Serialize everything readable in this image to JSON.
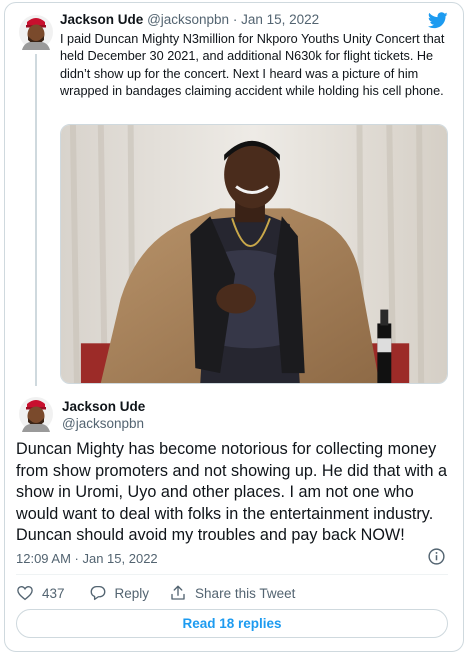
{
  "parent_tweet": {
    "author_name": "Jackson Ude",
    "author_handle": "@jacksonpbn",
    "separator": "·",
    "date": "Jan 15, 2022",
    "text": "I paid Duncan Mighty N3million for Nkporo Youths Unity Concert that held December 30 2021, and additional N630k for flight tickets. He didn’t  show up for the concert. Next I heard was a picture of him wrapped in bandages claiming accident while holding his cell phone.",
    "media": "photo of a man in a tan blazer seated in front of white curtains"
  },
  "main_tweet": {
    "author_name": "Jackson Ude",
    "author_handle": "@jacksonpbn",
    "text": "Duncan Mighty has become notorious for collecting money from show promoters and not showing up. He did that with a show in Uromi, Uyo and other places. I am not one who would want to deal with folks in the entertainment industry. Duncan should avoid my troubles and pay back NOW!",
    "timestamp": "12:09 AM · Jan 15, 2022"
  },
  "actions": {
    "like_count": "437",
    "reply_label": "Reply",
    "share_label": "Share this Tweet"
  },
  "read_replies_label": "Read 18 replies",
  "icons": {
    "brand": "twitter-bird-icon",
    "info": "info-icon",
    "like": "heart-icon",
    "reply": "reply-icon",
    "share": "share-icon"
  },
  "colors": {
    "accent": "#1d9bf0",
    "text": "#0f1419",
    "secondary_text": "#536471",
    "border": "#cfd9de"
  }
}
